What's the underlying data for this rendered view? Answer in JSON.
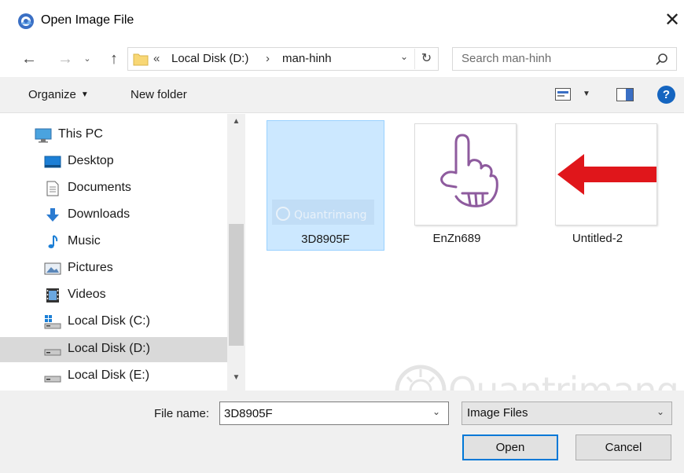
{
  "window": {
    "title": "Open Image File",
    "close_glyph": "✕"
  },
  "nav": {
    "back_glyph": "←",
    "forward_glyph": "→",
    "recent_glyph": "⌄",
    "up_glyph": "↑"
  },
  "address": {
    "overflow_glyph": "«",
    "separator_glyph": "›",
    "segments": [
      "Local Disk (D:)",
      "man-hinh"
    ],
    "dropdown_glyph": "⌄",
    "refresh_glyph": "↻"
  },
  "search": {
    "placeholder": "Search man-hinh"
  },
  "toolbar": {
    "organize_label": "Organize",
    "new_folder_label": "New folder",
    "help_label": "?"
  },
  "sidebar": {
    "items": [
      {
        "label": "This PC",
        "icon": "pc-icon"
      },
      {
        "label": "Desktop",
        "icon": "desktop-icon"
      },
      {
        "label": "Documents",
        "icon": "documents-icon"
      },
      {
        "label": "Downloads",
        "icon": "downloads-icon"
      },
      {
        "label": "Music",
        "icon": "music-icon"
      },
      {
        "label": "Pictures",
        "icon": "pictures-icon"
      },
      {
        "label": "Videos",
        "icon": "videos-icon"
      },
      {
        "label": "Local Disk (C:)",
        "icon": "drive-c-icon"
      },
      {
        "label": "Local Disk (D:)",
        "icon": "drive-icon",
        "selected": true
      },
      {
        "label": "Local Disk (E:)",
        "icon": "drive-icon"
      }
    ]
  },
  "files": [
    {
      "name": "3D8905F",
      "selected": true,
      "thumbnail_text": "Quantrimang"
    },
    {
      "name": "EnZn689",
      "selected": false
    },
    {
      "name": "Untitled-2",
      "selected": false
    }
  ],
  "watermark": {
    "text": "Quantrimang"
  },
  "bottom": {
    "file_name_label": "File name:",
    "file_name_value": "3D8905F",
    "file_type": "Image Files",
    "open_label": "Open",
    "cancel_label": "Cancel"
  },
  "colors": {
    "accent": "#0078d7",
    "selection": "#cce8ff",
    "arrow_red": "#e0161b",
    "hand_purple": "#8e5b9e",
    "help_blue": "#1565c0"
  }
}
